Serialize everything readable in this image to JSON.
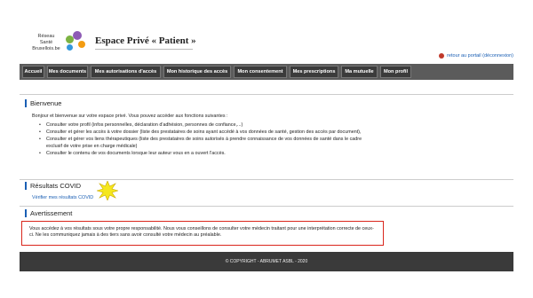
{
  "logo": {
    "line1": "Réseau",
    "line2": "Santé",
    "line3": "Bruxellois.be"
  },
  "header": {
    "title": "Espace Privé « Patient »",
    "portal_link": "retour au portail (déconnexion)"
  },
  "nav": {
    "items": [
      "Accueil",
      "Mes documents",
      "Mes autorisations d'accès",
      "Mon historique des accès",
      "Mon consentement",
      "Mes prescriptions",
      "Ma mutuelle",
      "Mon profil"
    ]
  },
  "bienvenue": {
    "title": "Bienvenue",
    "intro": "Bonjour et bienvenue sur votre espace privé. Vous pouvez accéder aux fonctions suivantes :",
    "bullets": [
      "Consulter votre profil (infos personnelles, déclaration d'adhésion, personnes de confiance,...)",
      "Consulter et gérer les accès à votre dossier (liste des prestataires de soins ayant accédé à vos données de santé, gestion des accès par document),",
      "Consulter et gérer vos liens thérapeutiques (liste des prestataires de soins autorisés à prendre connaissance de vos données de santé dans le cadre exclusif de votre prise en charge médicale)",
      "Consulter le contenu de vos documents lorsque leur auteur vous en a ouvert l'accès."
    ]
  },
  "covid": {
    "title": "Résultats COVID",
    "link": "Vérifier mes résultats COVID"
  },
  "avertissement": {
    "title": "Avertissement",
    "text": "Vous accédez à vos résultats sous votre propre responsabilité. Nous vous conseillons de consulter votre médecin traitant pour une interprétation correcte de ceux-ci. Ne les communiquez jamais à des tiers sans avoir consulté votre médecin au préalable."
  },
  "footer": {
    "text": "© COPYRIGHT - ABRUMET ASBL - 2020"
  },
  "colors": {
    "accent": "#1a5fb4",
    "navbar": "#5b5b5b",
    "warning_border": "#d9261c",
    "footer": "#3a3a3a"
  }
}
